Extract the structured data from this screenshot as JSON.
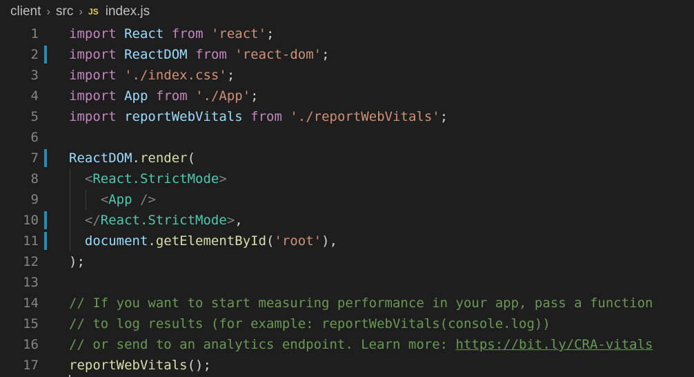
{
  "breadcrumb": {
    "folder1": "client",
    "folder2": "src",
    "file_badge": "JS",
    "file": "index.js",
    "separator": "›"
  },
  "lines": {
    "l1": {
      "n": "1",
      "t": [
        "import",
        " ",
        "React",
        " ",
        "from",
        " ",
        "'react'",
        ";"
      ]
    },
    "l2": {
      "n": "2",
      "t": [
        "import",
        " ",
        "ReactDOM",
        " ",
        "from",
        " ",
        "'react-dom'",
        ";"
      ]
    },
    "l3": {
      "n": "3",
      "t": [
        "import",
        " ",
        "'./index.css'",
        ";"
      ]
    },
    "l4": {
      "n": "4",
      "t": [
        "import",
        " ",
        "App",
        " ",
        "from",
        " ",
        "'./App'",
        ";"
      ]
    },
    "l5": {
      "n": "5",
      "t": [
        "import",
        " ",
        "reportWebVitals",
        " ",
        "from",
        " ",
        "'./reportWebVitals'",
        ";"
      ]
    },
    "l6": {
      "n": "6"
    },
    "l7": {
      "n": "7",
      "t": [
        "ReactDOM",
        ".",
        "render",
        "("
      ]
    },
    "l8": {
      "n": "8",
      "t": [
        "  ",
        "<",
        "React.StrictMode",
        ">"
      ]
    },
    "l9": {
      "n": "9",
      "t": [
        "    ",
        "<",
        "App",
        " />"
      ]
    },
    "l10": {
      "n": "10",
      "t": [
        "  ",
        "</",
        "React.StrictMode",
        ">",
        ","
      ]
    },
    "l11": {
      "n": "11",
      "t": [
        "  ",
        "document",
        ".",
        "getElementById",
        "(",
        "'root'",
        ")",
        ","
      ]
    },
    "l12": {
      "n": "12",
      "t": [
        ");"
      ]
    },
    "l13": {
      "n": "13"
    },
    "l14": {
      "n": "14",
      "t": [
        "// If you want to start measuring performance in your app, pass a function"
      ]
    },
    "l15": {
      "n": "15",
      "t": [
        "// to log results (for example: reportWebVitals(console.log))"
      ]
    },
    "l16": {
      "n": "16",
      "t": [
        "// or send to an analytics endpoint. Learn more: ",
        "https://bit.ly/CRA-vitals"
      ]
    },
    "l17": {
      "n": "17",
      "t": [
        "reportWebVitals",
        "();"
      ]
    }
  },
  "colors": {
    "background": "#1e1e1e",
    "keyword": "#c586c0",
    "identifier": "#9cdcfe",
    "string": "#ce9178",
    "function": "#dcdcaa",
    "tag": "#4ec9b0",
    "comment": "#6a9955",
    "modified_line_marker": "#2b8bb0"
  },
  "modified_lines": [
    2,
    7,
    10,
    11
  ]
}
